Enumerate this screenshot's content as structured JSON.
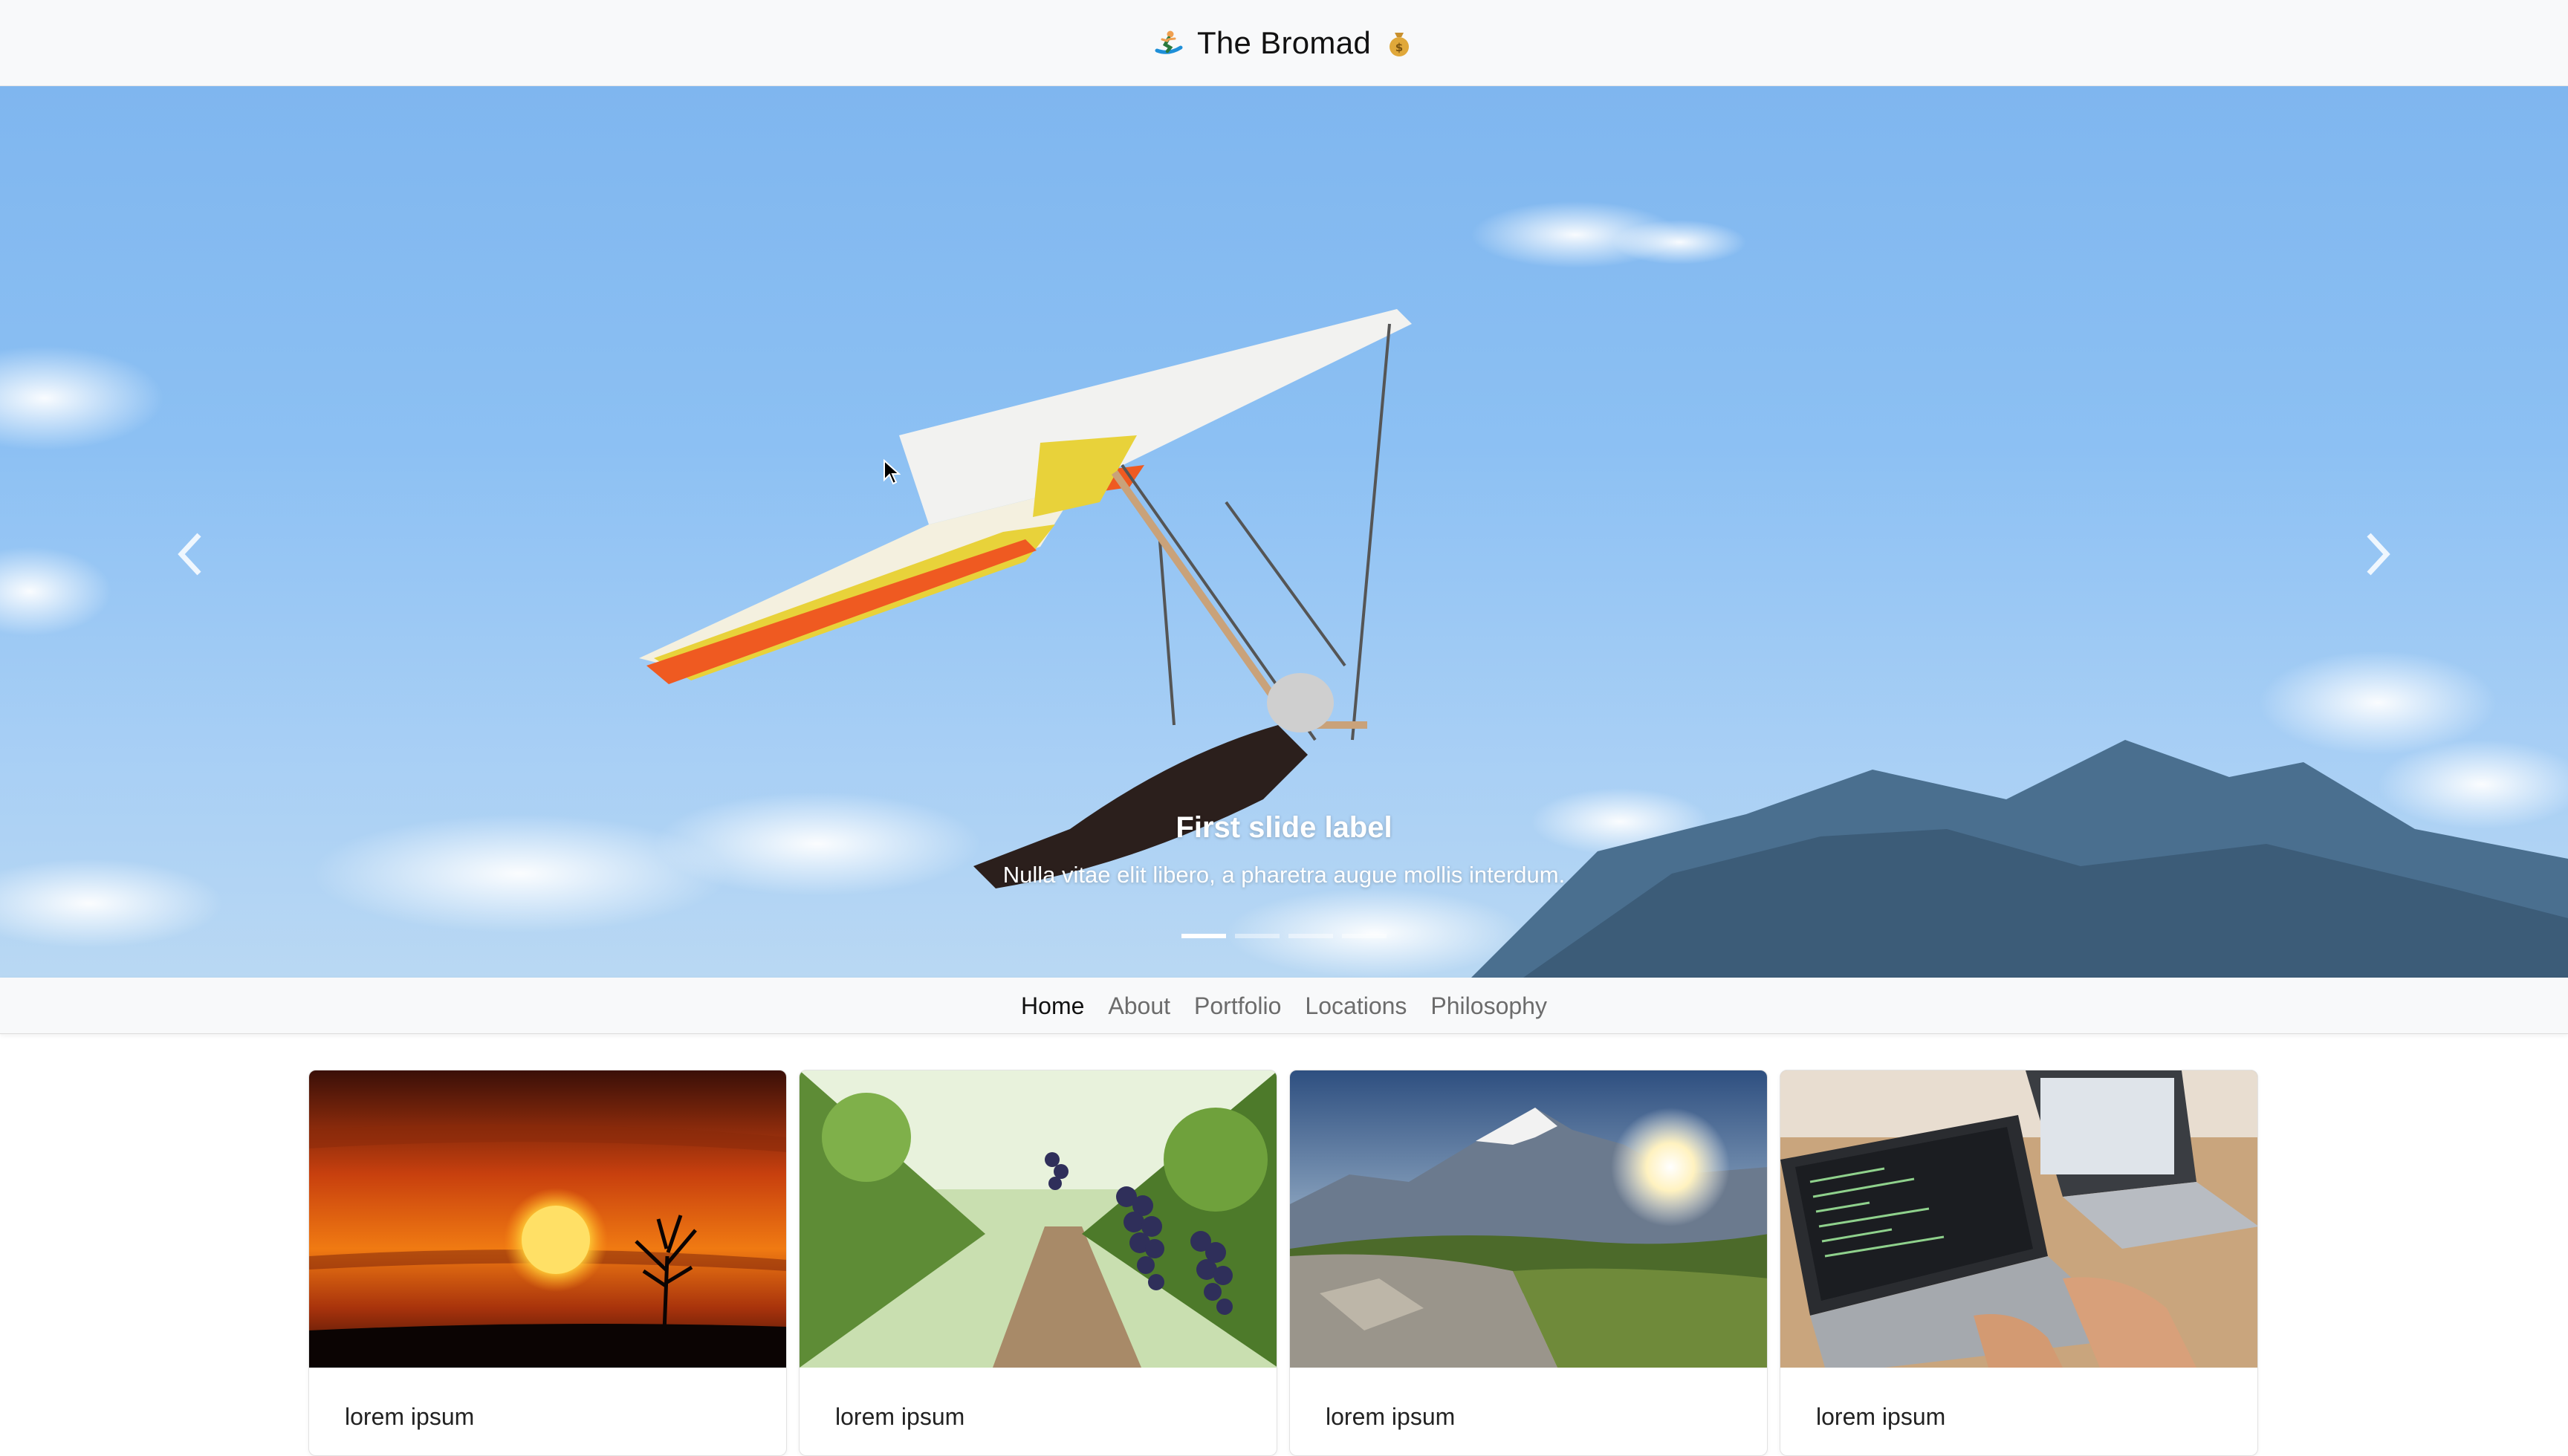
{
  "header": {
    "brand": "The Bromad",
    "left_icon": "surfer-icon",
    "right_icon": "money-bag-icon"
  },
  "carousel": {
    "caption_title": "First slide label",
    "caption_text": "Nulla vitae elit libero, a pharetra augue mollis interdum.",
    "prev_icon": "chevron-left-icon",
    "next_icon": "chevron-right-icon",
    "slide_count": 4,
    "active_slide": 1
  },
  "nav": {
    "items": [
      {
        "label": "Home",
        "active": true
      },
      {
        "label": "About",
        "active": false
      },
      {
        "label": "Portfolio",
        "active": false
      },
      {
        "label": "Locations",
        "active": false
      },
      {
        "label": "Philosophy",
        "active": false
      }
    ]
  },
  "cards": [
    {
      "title": "lorem ipsum",
      "image": "sunset-tree-photo"
    },
    {
      "title": "lorem ipsum",
      "image": "vineyard-grapes-photo"
    },
    {
      "title": "lorem ipsum",
      "image": "mountain-sunrise-photo"
    },
    {
      "title": "lorem ipsum",
      "image": "laptops-desk-photo"
    }
  ],
  "colors": {
    "header_bg": "#f8f9fa",
    "sky": "#8cc0f3",
    "nav_active": "#111111",
    "nav_inactive": "#6c6c6c"
  }
}
